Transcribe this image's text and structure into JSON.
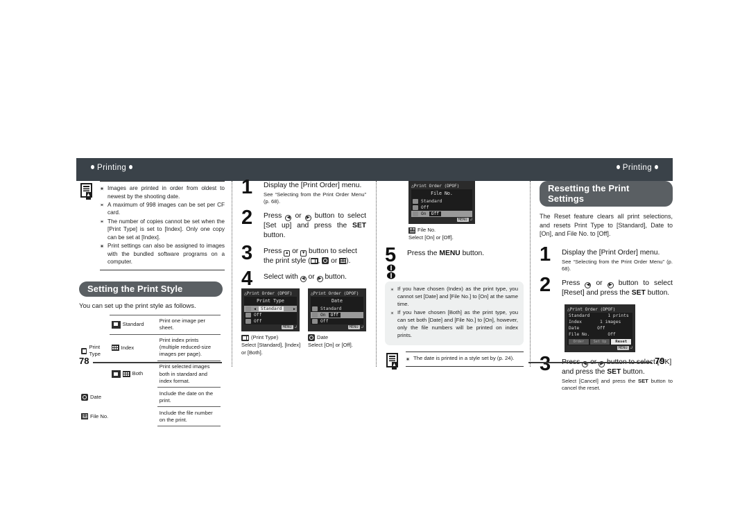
{
  "header": {
    "left_label": "Printing",
    "right_label": "Printing",
    "band_color": "#3a4249"
  },
  "page_numbers": {
    "left": "78",
    "right": "79"
  },
  "left_page": {
    "notes": [
      "Images are printed in order from oldest to newest by the shooting date.",
      "A maximum of 998 images can be set per CF card.",
      "The number of copies cannot be set when the [Print Type] is set to [Index]. Only one copy can be set at [Index].",
      "Print settings can also be assigned to images with the bundled software programs on a computer."
    ],
    "section_title": "Setting the Print Style",
    "lead": "You can set up the print style as follows.",
    "table": {
      "rows": [
        {
          "type": "Print Type",
          "option": "Standard",
          "desc": "Print one image per sheet."
        },
        {
          "type": "",
          "option": "Index",
          "desc": "Print index prints (multiple reduced-size images per page)."
        },
        {
          "type": "",
          "option": "Both",
          "desc": "Print selected images both in standard and index format."
        },
        {
          "type": "Date",
          "option": "",
          "desc": "Include the date on the print."
        },
        {
          "type": "File No.",
          "option": "",
          "desc": "Include the file number on the print."
        }
      ]
    }
  },
  "middle_column": {
    "steps": [
      {
        "number": "1",
        "main": "Display the [Print Order] menu.",
        "sub": "See “Selecting from the Print Order Menu” (p. 68)."
      },
      {
        "number": "2",
        "main_pre": "Press",
        "main_mid": "or",
        "main_post": "button to select [Set up] and press the",
        "bold_word": "SET",
        "main_end": "button."
      },
      {
        "number": "3",
        "main_pre": "Press",
        "main_mid": "or",
        "main_post": "button to select the print style (",
        "main_end": ")."
      },
      {
        "number": "4",
        "main_pre": "Select with",
        "main_mid": "or",
        "main_post": "button."
      }
    ],
    "lcd_print_type": {
      "title": "Print Order (DPOF)",
      "heading": "Print Type",
      "rows": [
        {
          "label": "Standard",
          "selected": true
        },
        {
          "label": "Off",
          "selected": false
        },
        {
          "label": "Off",
          "selected": false
        }
      ],
      "footer": "MENU"
    },
    "lcd_date": {
      "title": "Print Order (DPOF)",
      "heading": "Date",
      "rows": [
        {
          "label": "Standard",
          "value": "",
          "selected": false
        },
        {
          "label": "On",
          "value": "Off",
          "selected": true
        },
        {
          "label": "Off",
          "value": "",
          "selected": false
        }
      ],
      "footer": "MENU"
    },
    "caption_print_type": {
      "title": "(Print Type)",
      "text": "Select [Standard], [Index] or [Both]."
    },
    "caption_date": {
      "title": "Date",
      "text": "Select [On] or [Off]."
    }
  },
  "third_column": {
    "lcd_file_no": {
      "title": "Print Order (DPOF)",
      "heading": "File No.",
      "rows": [
        {
          "label": "Standard",
          "value": "",
          "selected": false
        },
        {
          "label": "Off",
          "value": "",
          "selected": false
        },
        {
          "label": "On",
          "value": "Off",
          "selected": true
        }
      ],
      "footer": "MENU"
    },
    "caption_file_no": {
      "title": "File No.",
      "text": "Select [On] or [Off]."
    },
    "step5": {
      "number": "5",
      "main_pre": "Press the",
      "bold_word": "MENU",
      "main_post": "button."
    },
    "tips": [
      "If you have chosen (Index) as the print type, you cannot set [Date] and [File No.] to [On] at the same time.",
      "If you have chosen [Both] as the print type, you can set both [Date] and [File No.] to [On], however, only the file numbers will be printed on index prints."
    ],
    "memo": "The date is printed in a style set by (p. 24)."
  },
  "right_page": {
    "section_title": "Resetting the Print Settings",
    "intro": "The Reset feature clears all print selections, and resets Print Type to [Standard], Date to [On], and File No. to [Off].",
    "steps": [
      {
        "number": "1",
        "main": "Display the [Print Order] menu.",
        "sub": "See “Selecting from the Print Order Menu” (p. 68)."
      },
      {
        "number": "2",
        "main_pre": "Press",
        "main_mid": "or",
        "main_post": "button to select [Reset] and press the",
        "bold_word": "SET",
        "main_end": "button."
      },
      {
        "number": "3",
        "main_pre": "Press",
        "main_mid": "or",
        "main_post": "button to select [OK] and press the",
        "bold_word": "SET",
        "main_end": "button.",
        "sub_pre": "Select [Cancel] and press the",
        "sub_bold": "SET",
        "sub_post": "button to cancel the reset."
      }
    ],
    "lcd_reset": {
      "title": "Print Order (DPOF)",
      "rows": [
        {
          "label": "Standard",
          "value": "1 prints"
        },
        {
          "label": "Index",
          "value": "1 images"
        },
        {
          "label": "Date",
          "value": "Off"
        },
        {
          "label": "File No.",
          "value": "Off"
        }
      ],
      "buttons": [
        "Order",
        "Set Up",
        "Reset"
      ],
      "active_button": "Reset",
      "footer": "MENU"
    }
  }
}
